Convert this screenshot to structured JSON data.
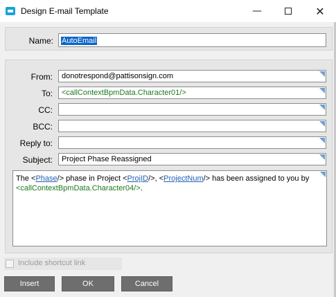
{
  "window": {
    "title": "Design E-mail Template",
    "minimize_glyph": "—",
    "close_glyph": "✕"
  },
  "form": {
    "name_label": "Name:",
    "name_value": "AutoEmail",
    "fields": [
      {
        "label": "From:",
        "value": "donotrespond@pattisonsign.com"
      },
      {
        "label": "To:",
        "value": "<callContextBpmData.Character01/>"
      },
      {
        "label": "CC:",
        "value": ""
      },
      {
        "label": "BCC:",
        "value": ""
      },
      {
        "label": "Reply to:",
        "value": ""
      },
      {
        "label": "Subject:",
        "value": "Project Phase Reassigned"
      }
    ]
  },
  "body": {
    "t1": "The <",
    "phase": "Phase",
    "t2": "/> phase in Project <",
    "projid": "ProjID",
    "t3": "/>, <",
    "projnum": "ProjectNum",
    "t4": "/> has been assigned to you by",
    "t5": "<callContextBpmData.Character04/>",
    "t6": "."
  },
  "options": {
    "include_shortcut_label": "Include shortcut link",
    "include_shortcut_checked": false
  },
  "buttons": {
    "insert": "Insert",
    "ok": "OK",
    "cancel": "Cancel"
  },
  "colors": {
    "accent": "#1aa3d6",
    "button_bg": "#6e6e6e",
    "selection": "#0a64c8",
    "tag_green": "#1a7a1a",
    "link_blue": "#1f5fb5",
    "field_marker": "#6d9fd2"
  },
  "icons": {
    "app": "email-template-icon",
    "minimize": "minimize-icon",
    "maximize": "maximize-icon",
    "close": "close-icon"
  }
}
